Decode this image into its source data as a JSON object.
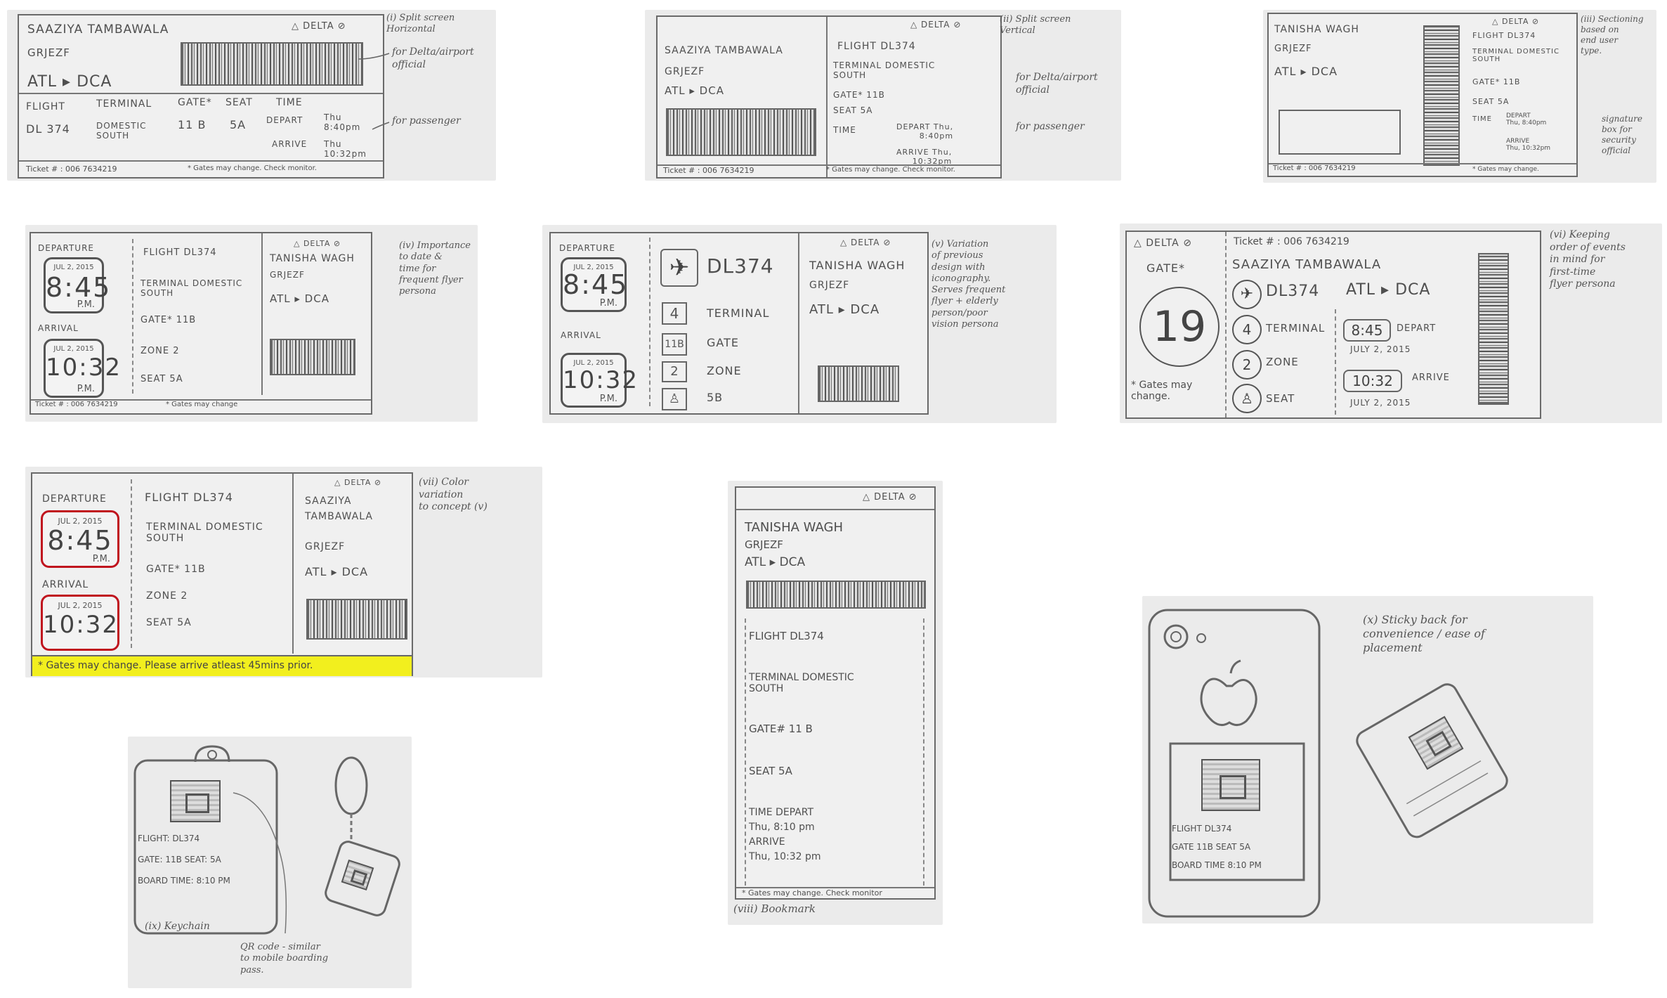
{
  "s1": {
    "name": "SAAZIYA TAMBAWALA",
    "conf": "GRJEZF",
    "route": "ATL ▸ DCA",
    "brand": "△ DELTA ⊘",
    "h_flight": "FLIGHT",
    "h_terminal": "TERMINAL",
    "h_gate": "GATE*",
    "h_seat": "SEAT",
    "h_time": "TIME",
    "flight": "DL 374",
    "terminal": "DOMESTIC\nSOUTH",
    "gate": "11 B",
    "seat": "5A",
    "depart": "DEPART",
    "depart_t": "Thu\n8:40pm",
    "arrive": "ARRIVE",
    "arrive_t": "Thu\n10:32pm",
    "ticket": "Ticket # : 006 7634219",
    "note": "* Gates may change. Check monitor.",
    "caption": "(i) Split screen\nHorizontal",
    "ann1": "for Delta/airport\nofficial",
    "ann2": "for passenger"
  },
  "s2": {
    "name": "SAAZIYA TAMBAWALA",
    "conf": "GRJEZF",
    "route": "ATL ▸ DCA",
    "brand": "△ DELTA ⊘",
    "flight": "FLIGHT  DL374",
    "terminal": "TERMINAL  DOMESTIC\nSOUTH",
    "gate": "GATE*    11B",
    "seat": "SEAT      5A",
    "time": "TIME",
    "depart": "DEPART  Thu,\n8:40pm",
    "arrive": "ARRIVE  Thu,\n10:32pm",
    "ticket": "Ticket # : 006 7634219",
    "note": "* Gates may change. Check monitor.",
    "caption": "(ii) Split screen\nVertical",
    "ann1": "for Delta/airport\nofficial",
    "ann2": "for passenger"
  },
  "s3": {
    "name": "TANISHA WAGH",
    "conf": "GRJEZF",
    "route": "ATL ▸ DCA",
    "brand": "△ DELTA ⊘",
    "flight": "FLIGHT  DL374",
    "terminal": "TERMINAL DOMESTIC\nSOUTH",
    "gate": "GATE*   11B",
    "seat": "SEAT    5A",
    "time": "TIME",
    "depart": "DEPART\nThu, 8:40pm",
    "arrive": "ARRIVE\nThu, 10:32pm",
    "ticket": "Ticket # : 006 7634219",
    "note": "* Gates may change.",
    "caption": "(iii) Sectioning\nbased on\nend user\ntype.",
    "ann": "signature\nbox for\nsecurity\nofficial"
  },
  "s4": {
    "departure": "DEPARTURE",
    "arrival": "ARRIVAL",
    "date": "JUL 2, 2015",
    "dep_time": "8:45",
    "arr_time": "10:32",
    "pm": "P.M.",
    "flight": "FLIGHT  DL374",
    "terminal": "TERMINAL DOMESTIC\nSOUTH",
    "gate": "GATE*   11B",
    "zone": "ZONE    2",
    "seat": "SEAT    5A",
    "brand": "△ DELTA ⊘",
    "name": "TANISHA WAGH",
    "conf": "GRJEZF",
    "route": "ATL ▸ DCA",
    "ticket": "Ticket # : 006 7634219",
    "note": "* Gates may change",
    "caption": "(iv) Importance\nto date &\ntime for\nfrequent flyer\npersona"
  },
  "s5": {
    "departure": "DEPARTURE",
    "arrival": "ARRIVAL",
    "date": "JUL 2, 2015",
    "dep_time": "8:45",
    "arr_time": "10:32",
    "pm": "P.M.",
    "flight": "DL374",
    "terminal": "TERMINAL",
    "terminal_v": "4",
    "gate": "GATE",
    "gate_v": "11B",
    "zone": "ZONE",
    "zone_v": "2",
    "seat": "5B",
    "brand": "△ DELTA ⊘",
    "name": "TANISHA WAGH",
    "conf": "GRJEZF",
    "route": "ATL ▸ DCA",
    "caption": "(v) Variation\nof previous\ndesign with\niconography.\nServes frequent\nflyer + elderly\nperson/poor\nvision persona"
  },
  "s6": {
    "brand": "△ DELTA ⊘",
    "gate_label": "GATE*",
    "gate": "19",
    "note": "* Gates may\nchange.",
    "ticket": "Ticket # : 006 7634219",
    "name": "SAAZIYA TAMBAWALA",
    "flight": "DL374",
    "route": "ATL ▸ DCA",
    "terminal_v": "4",
    "terminal": "TERMINAL",
    "zone_v": "2",
    "zone": "ZONE",
    "seat": "SEAT",
    "dep_time": "8:45",
    "depart": "DEPART",
    "dep_date": "JULY 2, 2015",
    "arr_time": "10:32",
    "arrive": "ARRIVE",
    "arr_date": "JULY 2, 2015",
    "caption": "(vi) Keeping\norder of events\nin mind for\nfirst-time\nflyer persona"
  },
  "s7": {
    "departure": "DEPARTURE",
    "arrival": "ARRIVAL",
    "date": "JUL 2, 2015",
    "dep_time": "8:45",
    "arr_time": "10:32",
    "pm": "P.M.",
    "flight": "FLIGHT  DL374",
    "terminal": "TERMINAL  DOMESTIC\nSOUTH",
    "gate": "GATE*      11B",
    "zone": "ZONE        2",
    "seat": "SEAT        5A",
    "brand": "△ DELTA ⊘",
    "name": "SAAZIYA\nTAMBAWALA",
    "conf": "GRJEZF",
    "route": "ATL ▸ DCA",
    "note": "* Gates may change. Please arrive atleast 45mins prior.",
    "caption": "(vii) Color\nvariation\nto concept (v)",
    "colors": {
      "alert": "#c0141e",
      "banner": "#f2ef1e"
    }
  },
  "s8": {
    "brand": "△ DELTA ⊘",
    "name": "TANISHA WAGH",
    "conf": "GRJEZF",
    "route": "ATL ▸ DCA",
    "flight": "FLIGHT   DL374",
    "terminal": "TERMINAL  DOMESTIC\nSOUTH",
    "gate": "GATE#     11 B",
    "seat": "SEAT      5A",
    "time": "TIME      DEPART\nThu, 8:10 pm\nARRIVE\nThu, 10:32 pm",
    "note": "* Gates may change. Check monitor",
    "caption": "(viii) Bookmark"
  },
  "s9": {
    "flight": "FLIGHT: DL374",
    "gate": "GATE: 11B   SEAT: 5A",
    "board": "BOARD TIME: 8:10 PM",
    "caption": "(ix) Keychain",
    "ann": "QR code - similar\nto mobile boarding\npass."
  },
  "s10": {
    "flight": "FLIGHT  DL374",
    "gate": "GATE 11B  SEAT 5A",
    "board": "BOARD TIME  8:10 PM",
    "caption": "(x) Sticky back for\nconvenience / ease of\nplacement"
  }
}
